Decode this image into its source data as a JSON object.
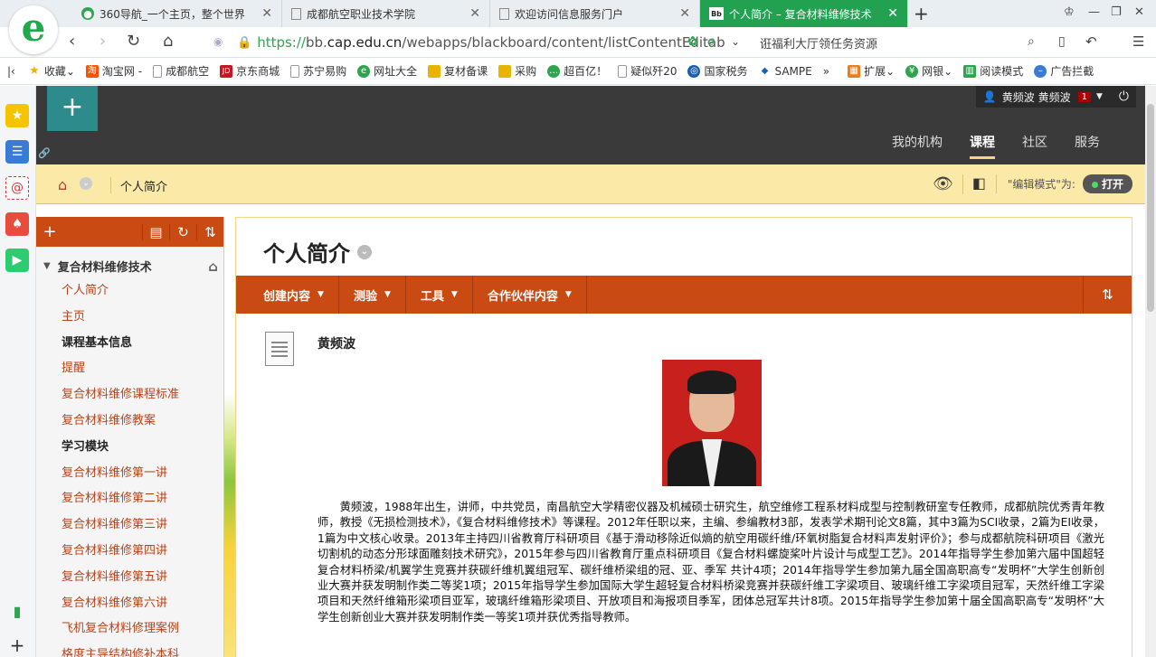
{
  "browser": {
    "logo_letter": "e",
    "tabs": [
      {
        "title": "360导航_一个主页，整个世界",
        "active": false
      },
      {
        "title": "成都航空职业技术学院",
        "active": false
      },
      {
        "title": "欢迎访问信息服务门户",
        "active": false
      },
      {
        "title": "个人简介 – 复合材料维修技术",
        "active": true
      }
    ],
    "tab_favicon_bb": "Bb",
    "url": {
      "scheme": "https://",
      "host_pre": "bb.",
      "host_main": "cap.edu.cn",
      "path": "/webapps/blackboard/content/listContentEditab"
    },
    "search_text": "诳福利大厅领任务资源"
  },
  "bookmarks": [
    {
      "label": "收藏",
      "color": "#f0b400"
    },
    {
      "label": "淘宝网 -",
      "color": "#ff5000"
    },
    {
      "label": "成都航空",
      "color": "#999999"
    },
    {
      "label": "京东商城",
      "color": "#c81623"
    },
    {
      "label": "苏宁易购",
      "color": "#999999"
    },
    {
      "label": "网址大全",
      "color": "#2ea44f"
    },
    {
      "label": "复材备课",
      "color": "#e8b400"
    },
    {
      "label": "采购",
      "color": "#e8b400"
    },
    {
      "label": "超百亿！",
      "color": "#2ea44f"
    },
    {
      "label": "疑似歼20",
      "color": "#999999"
    },
    {
      "label": "国家税务",
      "color": "#1a5fb4"
    },
    {
      "label": "SAMPE",
      "color": "#1a5fb4"
    },
    {
      "label": "»",
      "color": ""
    },
    {
      "label": "扩展",
      "color": "#e67e22"
    },
    {
      "label": "网银",
      "color": "#2ea44f"
    },
    {
      "label": "阅读模式",
      "color": "#2ea44f"
    },
    {
      "label": "广告拦截",
      "color": "#3a7bd5"
    }
  ],
  "header": {
    "user": "黄频波 黄频波",
    "notifications": "1",
    "nav": [
      {
        "label": "我的机构",
        "active": false
      },
      {
        "label": "课程",
        "active": true
      },
      {
        "label": "社区",
        "active": false
      },
      {
        "label": "服务",
        "active": false
      }
    ]
  },
  "breadcrumb": {
    "current": "个人简介",
    "edit_mode_label": "\"编辑模式\"为:",
    "edit_mode_value": "打开"
  },
  "course_menu": {
    "course_title": "复合材料维修技术",
    "items": [
      {
        "label": "个人简介",
        "type": "link"
      },
      {
        "label": "主页",
        "type": "link"
      },
      {
        "label": "课程基本信息",
        "type": "section"
      },
      {
        "label": "提醒",
        "type": "link"
      },
      {
        "label": "复合材料维修课程标准",
        "type": "link"
      },
      {
        "label": "复合材料维修教案",
        "type": "link"
      },
      {
        "label": "学习模块",
        "type": "section"
      },
      {
        "label": "复合材料维修第一讲",
        "type": "link"
      },
      {
        "label": "复合材料维修第二讲",
        "type": "link"
      },
      {
        "label": "复合材料维修第三讲",
        "type": "link"
      },
      {
        "label": "复合材料维修第四讲",
        "type": "link"
      },
      {
        "label": "复合材料维修第五讲",
        "type": "link"
      },
      {
        "label": "复合材料维修第六讲",
        "type": "link"
      },
      {
        "label": "飞机复合材料修理案例",
        "type": "link"
      },
      {
        "label": "格度主导结构修补本科",
        "type": "link"
      }
    ]
  },
  "content": {
    "page_title": "个人简介",
    "actions": [
      "创建内容",
      "测验",
      "工具",
      "合作伙伴内容"
    ],
    "item_name": "黄频波",
    "bio": "黄频波，1988年出生，讲师，中共党员，南昌航空大学精密仪器及机械硕士研究生，航空维修工程系材料成型与控制教研室专任教师，成都航院优秀青年教师，教授《无损检测技术》，《复合材料维修技术》等课程。2012年任职以来，主编、参编教材3部，发表学术期刊论文8篇，其中3篇为SCI收录，2篇为EI收录，1篇为中文核心收录。2013年主持四川省教育厅科研项目《基于滑动移除近似熵的航空用碳纤维/环氧树脂复合材料声发射评价》；参与成都航院科研项目《激光切割机的动态分形球面雕刻技术研究》，2015年参与四川省教育厅重点科研项目《复合材料螺旋桨叶片设计与成型工艺》。2014年指导学生参加第六届中国超轻复合材料桥梁/机翼学生竞赛并获碳纤维机翼组冠军、碳纤维桥梁组的冠、亚、季军 共计4项；2014年指导学生参加第九届全国高职高专“发明杯”大学生创新创业大赛并获发明制作类二等奖1项；2015年指导学生参加国际大学生超轻复合材料桥梁竞赛并获碳纤维工字梁项目、玻璃纤维工字梁项目冠军，天然纤维工字梁项目和天然纤维箱形梁项目亚军，玻璃纤维箱形梁项目、开放项目和海报项目季军，团体总冠军共计8项。2015年指导学生参加第十届全国高职高专“发明杯”大学生创新创业大赛并获发明制作类一等奖1项并获优秀指导教师。"
  }
}
